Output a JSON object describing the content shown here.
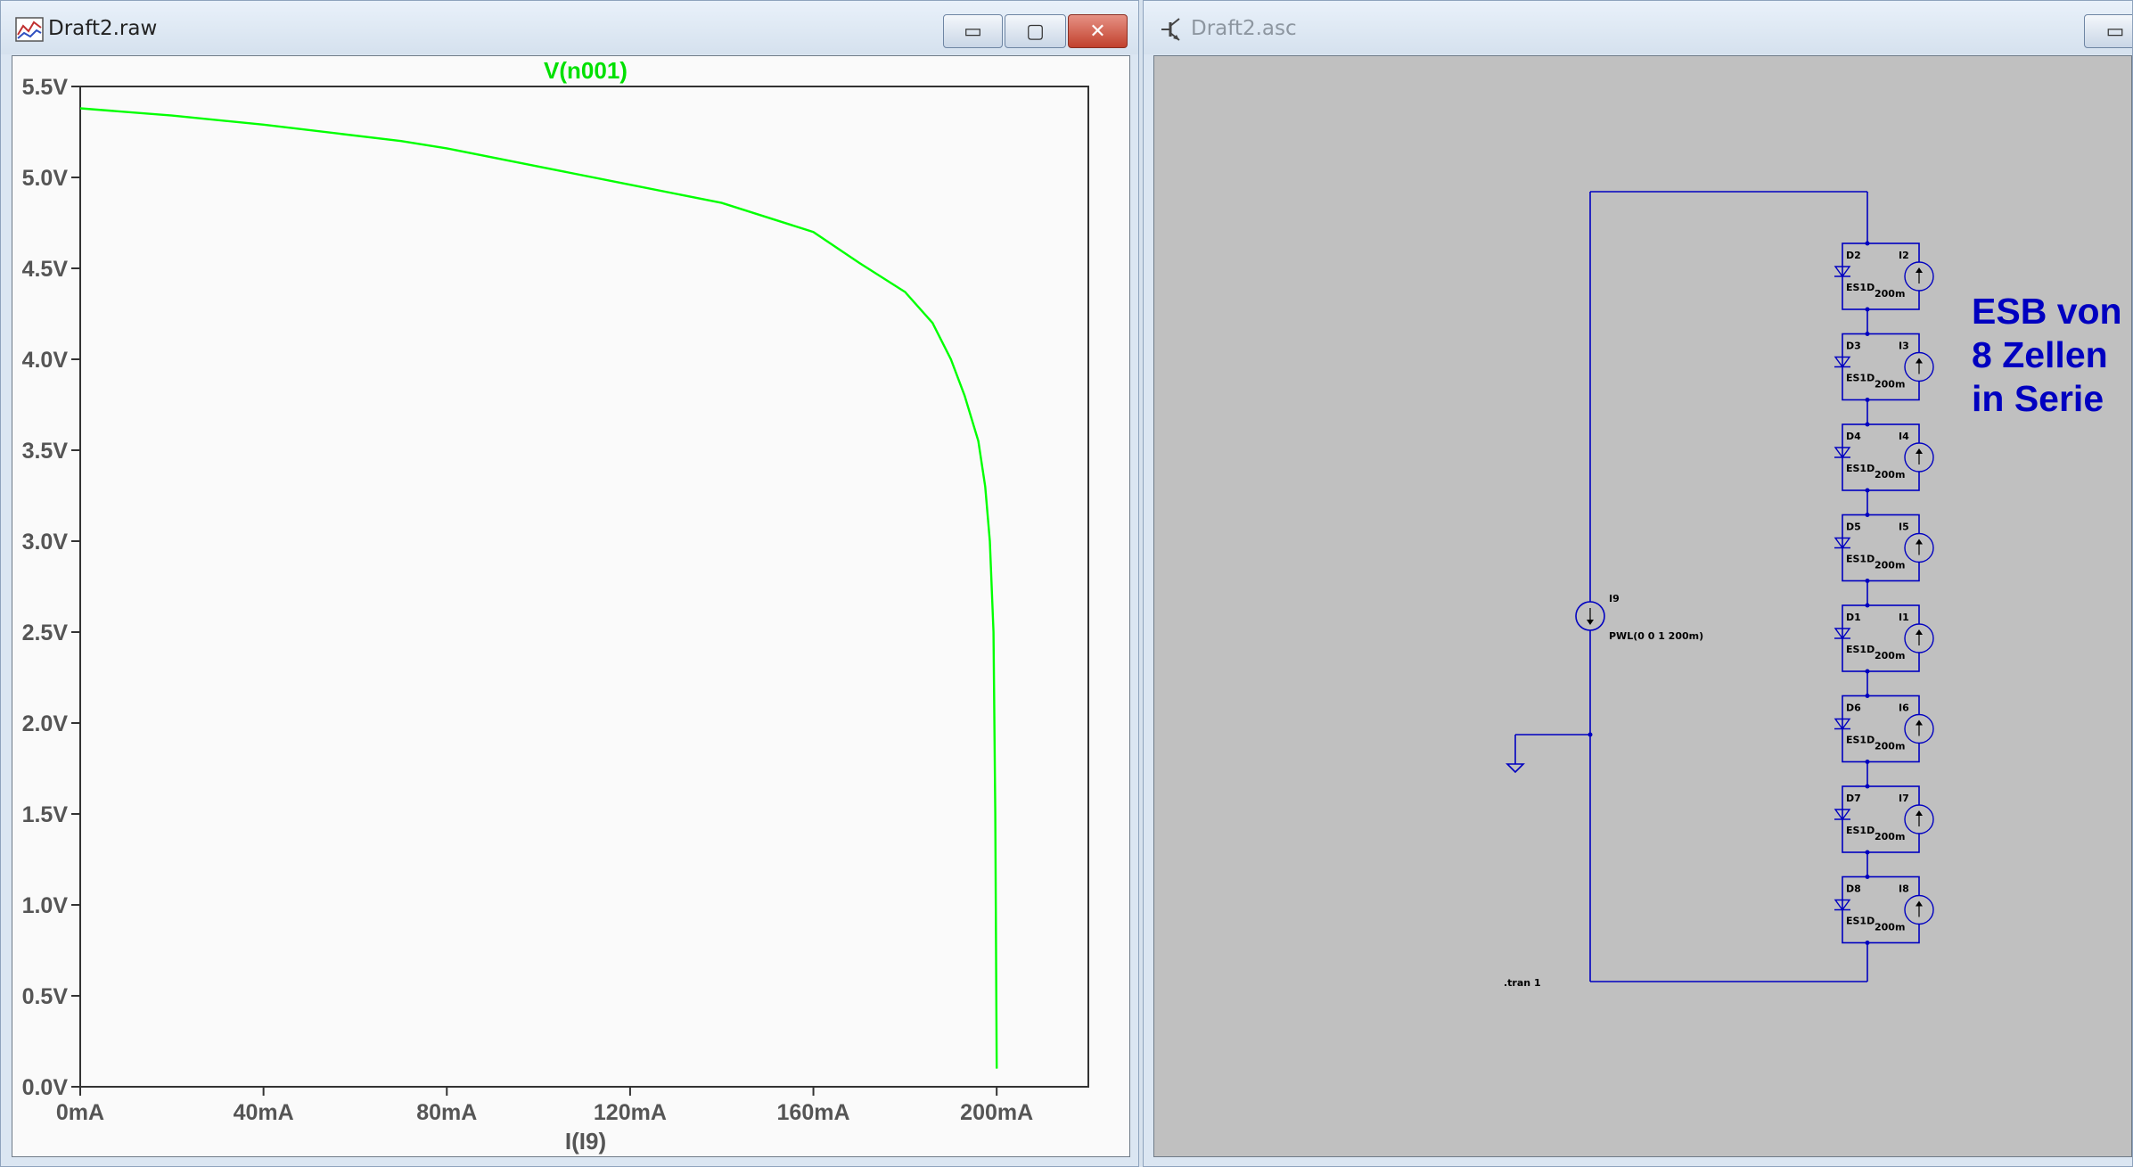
{
  "plot_window": {
    "title": "Draft2.raw",
    "buttons": {
      "minimize": "▭",
      "maximize": "▢",
      "close": "✕"
    },
    "trace_label": "V(n001)",
    "trace_color": "#00ff00",
    "x_axis_label": "I(I9)"
  },
  "chart_data": {
    "type": "line",
    "title": "V(n001)",
    "xlabel": "I(I9)",
    "ylabel": "",
    "xlim": [
      0,
      220
    ],
    "ylim": [
      0,
      5.5
    ],
    "x_ticks": [
      "0mA",
      "40mA",
      "80mA",
      "120mA",
      "160mA",
      "200mA"
    ],
    "x_tick_values": [
      0,
      40,
      80,
      120,
      160,
      200
    ],
    "y_ticks": [
      "0.0V",
      "0.5V",
      "1.0V",
      "1.5V",
      "2.0V",
      "2.5V",
      "3.0V",
      "3.5V",
      "4.0V",
      "4.5V",
      "5.0V",
      "5.5V"
    ],
    "y_tick_values": [
      0,
      0.5,
      1.0,
      1.5,
      2.0,
      2.5,
      3.0,
      3.5,
      4.0,
      4.5,
      5.0,
      5.5
    ],
    "grid": false,
    "series": [
      {
        "name": "V(n001)",
        "color": "#00ff00",
        "x": [
          0,
          20,
          40,
          70,
          80,
          100,
          120,
          140,
          160,
          170,
          180,
          186,
          190,
          193,
          196,
          197.5,
          198.5,
          199.3,
          199.7,
          200
        ],
        "y": [
          5.38,
          5.34,
          5.29,
          5.2,
          5.16,
          5.06,
          4.96,
          4.86,
          4.7,
          4.53,
          4.37,
          4.2,
          4.0,
          3.8,
          3.55,
          3.3,
          3.0,
          2.5,
          1.5,
          0.1
        ]
      }
    ]
  },
  "schematic_window": {
    "title": "Draft2.asc",
    "buttons": {
      "minimize": "▭"
    },
    "source": {
      "name": "I9",
      "value": "PWL(0 0 1 200m)"
    },
    "cells": [
      {
        "diode": "D2",
        "source": "I2",
        "model": "ES1D",
        "current": "200m"
      },
      {
        "diode": "D3",
        "source": "I3",
        "model": "ES1D",
        "current": "200m"
      },
      {
        "diode": "D4",
        "source": "I4",
        "model": "ES1D",
        "current": "200m"
      },
      {
        "diode": "D5",
        "source": "I5",
        "model": "ES1D",
        "current": "200m"
      },
      {
        "diode": "D1",
        "source": "I1",
        "model": "ES1D",
        "current": "200m"
      },
      {
        "diode": "D6",
        "source": "I6",
        "model": "ES1D",
        "current": "200m"
      },
      {
        "diode": "D7",
        "source": "I7",
        "model": "ES1D",
        "current": "200m"
      },
      {
        "diode": "D8",
        "source": "I8",
        "model": "ES1D",
        "current": "200m"
      }
    ],
    "directive": ".tran 1",
    "annotation": [
      "ESB von",
      "8 Zellen",
      "in Serie"
    ],
    "wire_color": "#0000c0",
    "annotation_color": "#0000c0"
  }
}
